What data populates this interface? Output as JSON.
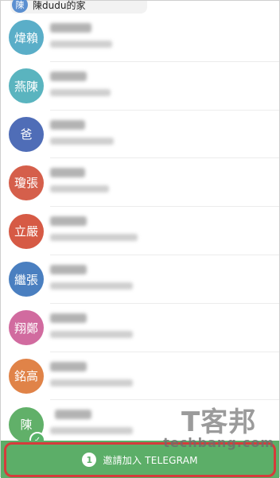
{
  "top_chip": {
    "avatar_text": "陳",
    "label": "陳dudu的家"
  },
  "contacts": [
    {
      "avatar_text": "煒賴",
      "color": "#5aaec8"
    },
    {
      "avatar_text": "燕陳",
      "color": "#5ab4bf"
    },
    {
      "avatar_text": "爸",
      "color": "#4f6db7"
    },
    {
      "avatar_text": "瓊張",
      "color": "#d55f4b"
    },
    {
      "avatar_text": "立嚴",
      "color": "#d65a45"
    },
    {
      "avatar_text": "繼張",
      "color": "#4a7fc0"
    },
    {
      "avatar_text": "翔鄭",
      "color": "#d16b9f"
    },
    {
      "avatar_text": "銘高",
      "color": "#e08348"
    },
    {
      "avatar_text": "陳",
      "color": "#61b069"
    }
  ],
  "invite": {
    "count": "1",
    "label": "邀請加入 TELEGRAM",
    "bar_color": "#5cae68",
    "highlight_color": "#d63b3b"
  },
  "watermark": {
    "logo": "T客邦",
    "sub": "techbang.com"
  }
}
